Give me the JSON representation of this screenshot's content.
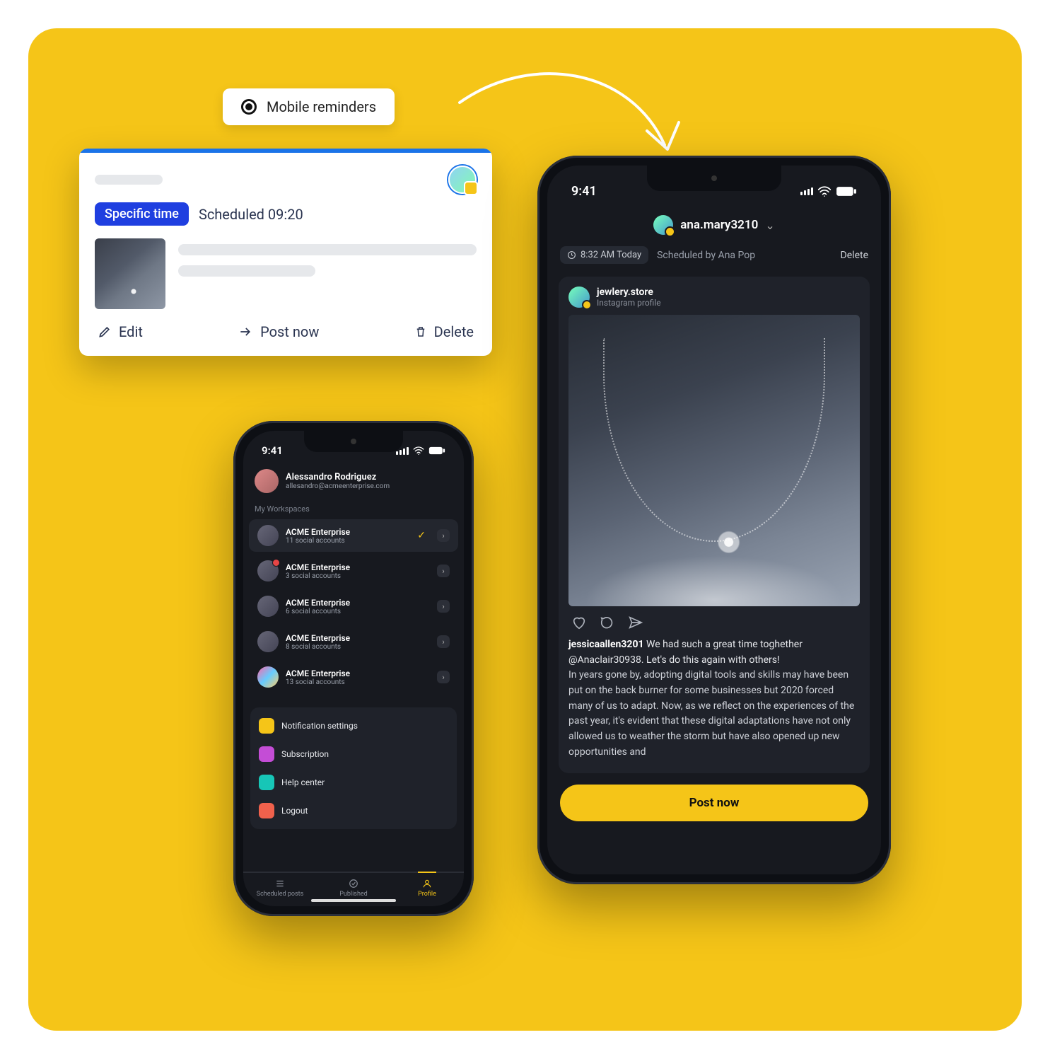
{
  "pill_label": "Mobile reminders",
  "card": {
    "badge": "Specific time",
    "scheduled": "Scheduled 09:20",
    "edit": "Edit",
    "postnow": "Post now",
    "delete": "Delete"
  },
  "small_phone": {
    "time": "9:41",
    "user_name": "Alessandro Rodriguez",
    "user_email": "allesandro@acmeenterprise.com",
    "workspaces_label": "My Workspaces",
    "workspaces": [
      {
        "title": "ACME Enterprise",
        "sub": "11 social accounts",
        "selected": true
      },
      {
        "title": "ACME Enterprise",
        "sub": "3 social accounts"
      },
      {
        "title": "ACME Enterprise",
        "sub": "6 social accounts"
      },
      {
        "title": "ACME Enterprise",
        "sub": "8 social accounts"
      },
      {
        "title": "ACME Enterprise",
        "sub": "13 social accounts"
      }
    ],
    "notif": "Notification settings",
    "subscription": "Subscription",
    "help": "Help center",
    "logout": "Logout",
    "tab_scheduled": "Scheduled posts",
    "tab_published": "Published",
    "tab_profile": "Profile"
  },
  "big_phone": {
    "time": "9:41",
    "username": "ana.mary3210",
    "pill_time": "8:32 AM Today",
    "scheduled_by": "Scheduled by Ana Pop",
    "delete": "Delete",
    "account_name": "jewlery.store",
    "account_type": "Instagram profile",
    "caption_user": "jessicaallen3201",
    "caption_lead": "We had such a  great time toghether @Anaclair30938. Let's do this again with others!",
    "caption_body": "In years gone by, adopting digital tools and skills may have been put on the back burner for some businesses but 2020 forced many of us to adapt. Now, as we reflect on the experiences of the past year, it's evident that these digital adaptations have not only allowed us to weather the storm but have also opened up new opportunities and",
    "post_now": "Post now"
  }
}
